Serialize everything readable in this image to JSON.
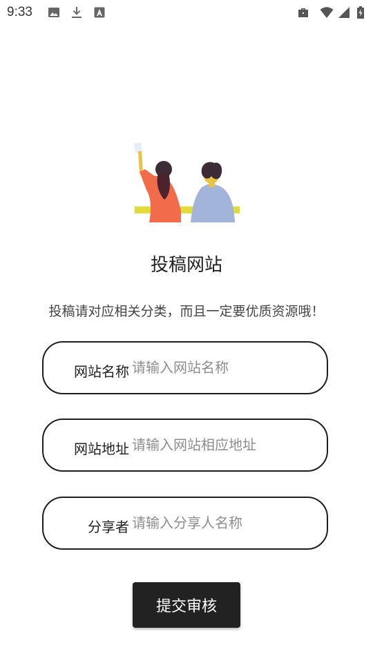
{
  "status_bar": {
    "time": "9:33",
    "left_icons": [
      "image-icon",
      "download-icon",
      "text-a-icon"
    ],
    "right_icons": [
      "briefcase-icon",
      "wifi-icon",
      "signal-icon",
      "battery-charging-icon"
    ]
  },
  "header": {
    "title": "投稿网站",
    "description": "投稿请对应相关分类，而且一定要优质资源哦！"
  },
  "form": {
    "fields": [
      {
        "label": "网站名称",
        "value": "",
        "placeholder": "请输入网站名称"
      },
      {
        "label": "网站地址",
        "value": "",
        "placeholder": "请输入网站相应地址"
      },
      {
        "label": "分享者",
        "value": "",
        "placeholder": "请输入分享人名称"
      }
    ],
    "submit_label": "提交审核"
  },
  "colors": {
    "accent": "#222222",
    "illustration_orange": "#f26b4a",
    "illustration_blue": "#a3b4db",
    "illustration_yellow": "#e2dc3a"
  }
}
